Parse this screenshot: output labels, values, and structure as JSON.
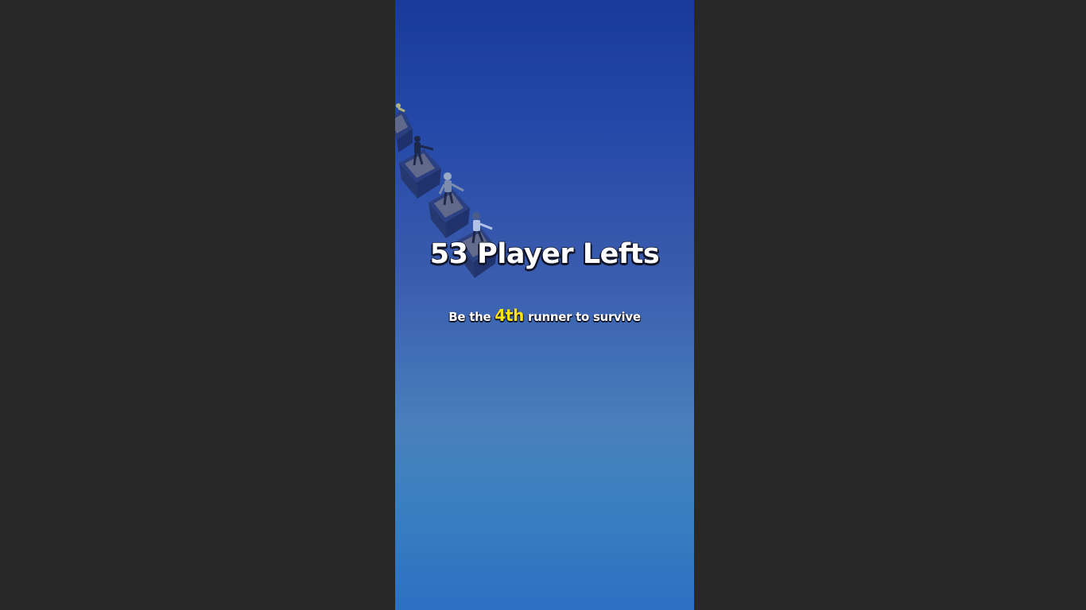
{
  "game": {
    "players_left_text": "53 Player Lefts",
    "objective": {
      "prefix": "Be the ",
      "rank": "4th",
      "suffix": " runner to survive"
    }
  },
  "colors": {
    "outer_background": "#282828",
    "gradient_top": "#173a9c",
    "gradient_bottom": "#2d6fc2",
    "rank_highlight": "#ffe31a"
  }
}
